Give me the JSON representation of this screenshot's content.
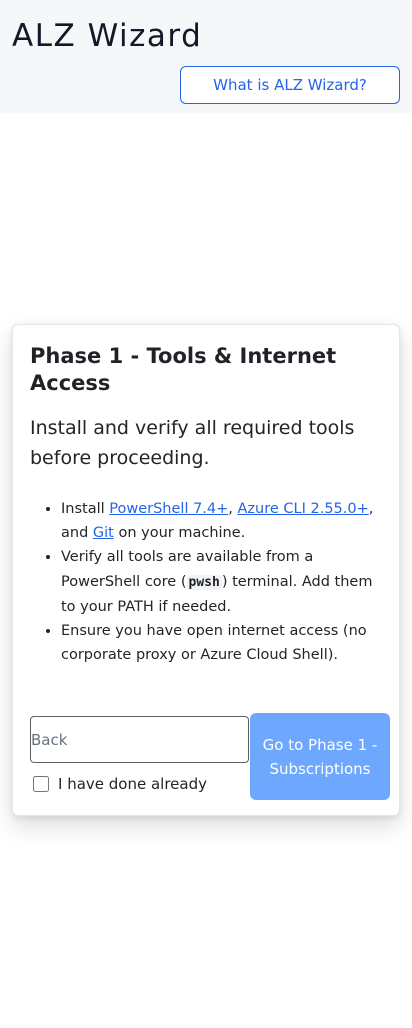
{
  "header": {
    "title": "ALZ Wizard",
    "help_button_label": "What is ALZ Wizard?"
  },
  "card": {
    "title": "Phase 1 - Tools & Internet Access",
    "subtitle": "Install and verify all required tools before proceeding.",
    "steps": {
      "item1": {
        "prefix": "Install ",
        "link_powershell": "PowerShell 7.4+",
        "sep1": ", ",
        "link_azure_cli": "Azure CLI 2.55.0+",
        "sep2": ", and ",
        "link_git": "Git",
        "suffix": " on your machine."
      },
      "item2": {
        "prefix": "Verify all tools are available from a PowerShell core (",
        "code": "pwsh",
        "suffix": ") terminal. Add them to your PATH if needed."
      },
      "item3": {
        "text": "Ensure you have open internet access (no corporate proxy or Azure Cloud Shell)."
      }
    },
    "back_input": {
      "value": "",
      "placeholder": "Back"
    },
    "next_button_label": "Go to Phase 1 - Subscriptions",
    "done_checkbox": {
      "checked": false,
      "label": "I have done already"
    }
  },
  "colors": {
    "accent": "#2563eb",
    "primary_button_disabled": "#6ea8fe",
    "header_background": "#f6f7f9"
  }
}
